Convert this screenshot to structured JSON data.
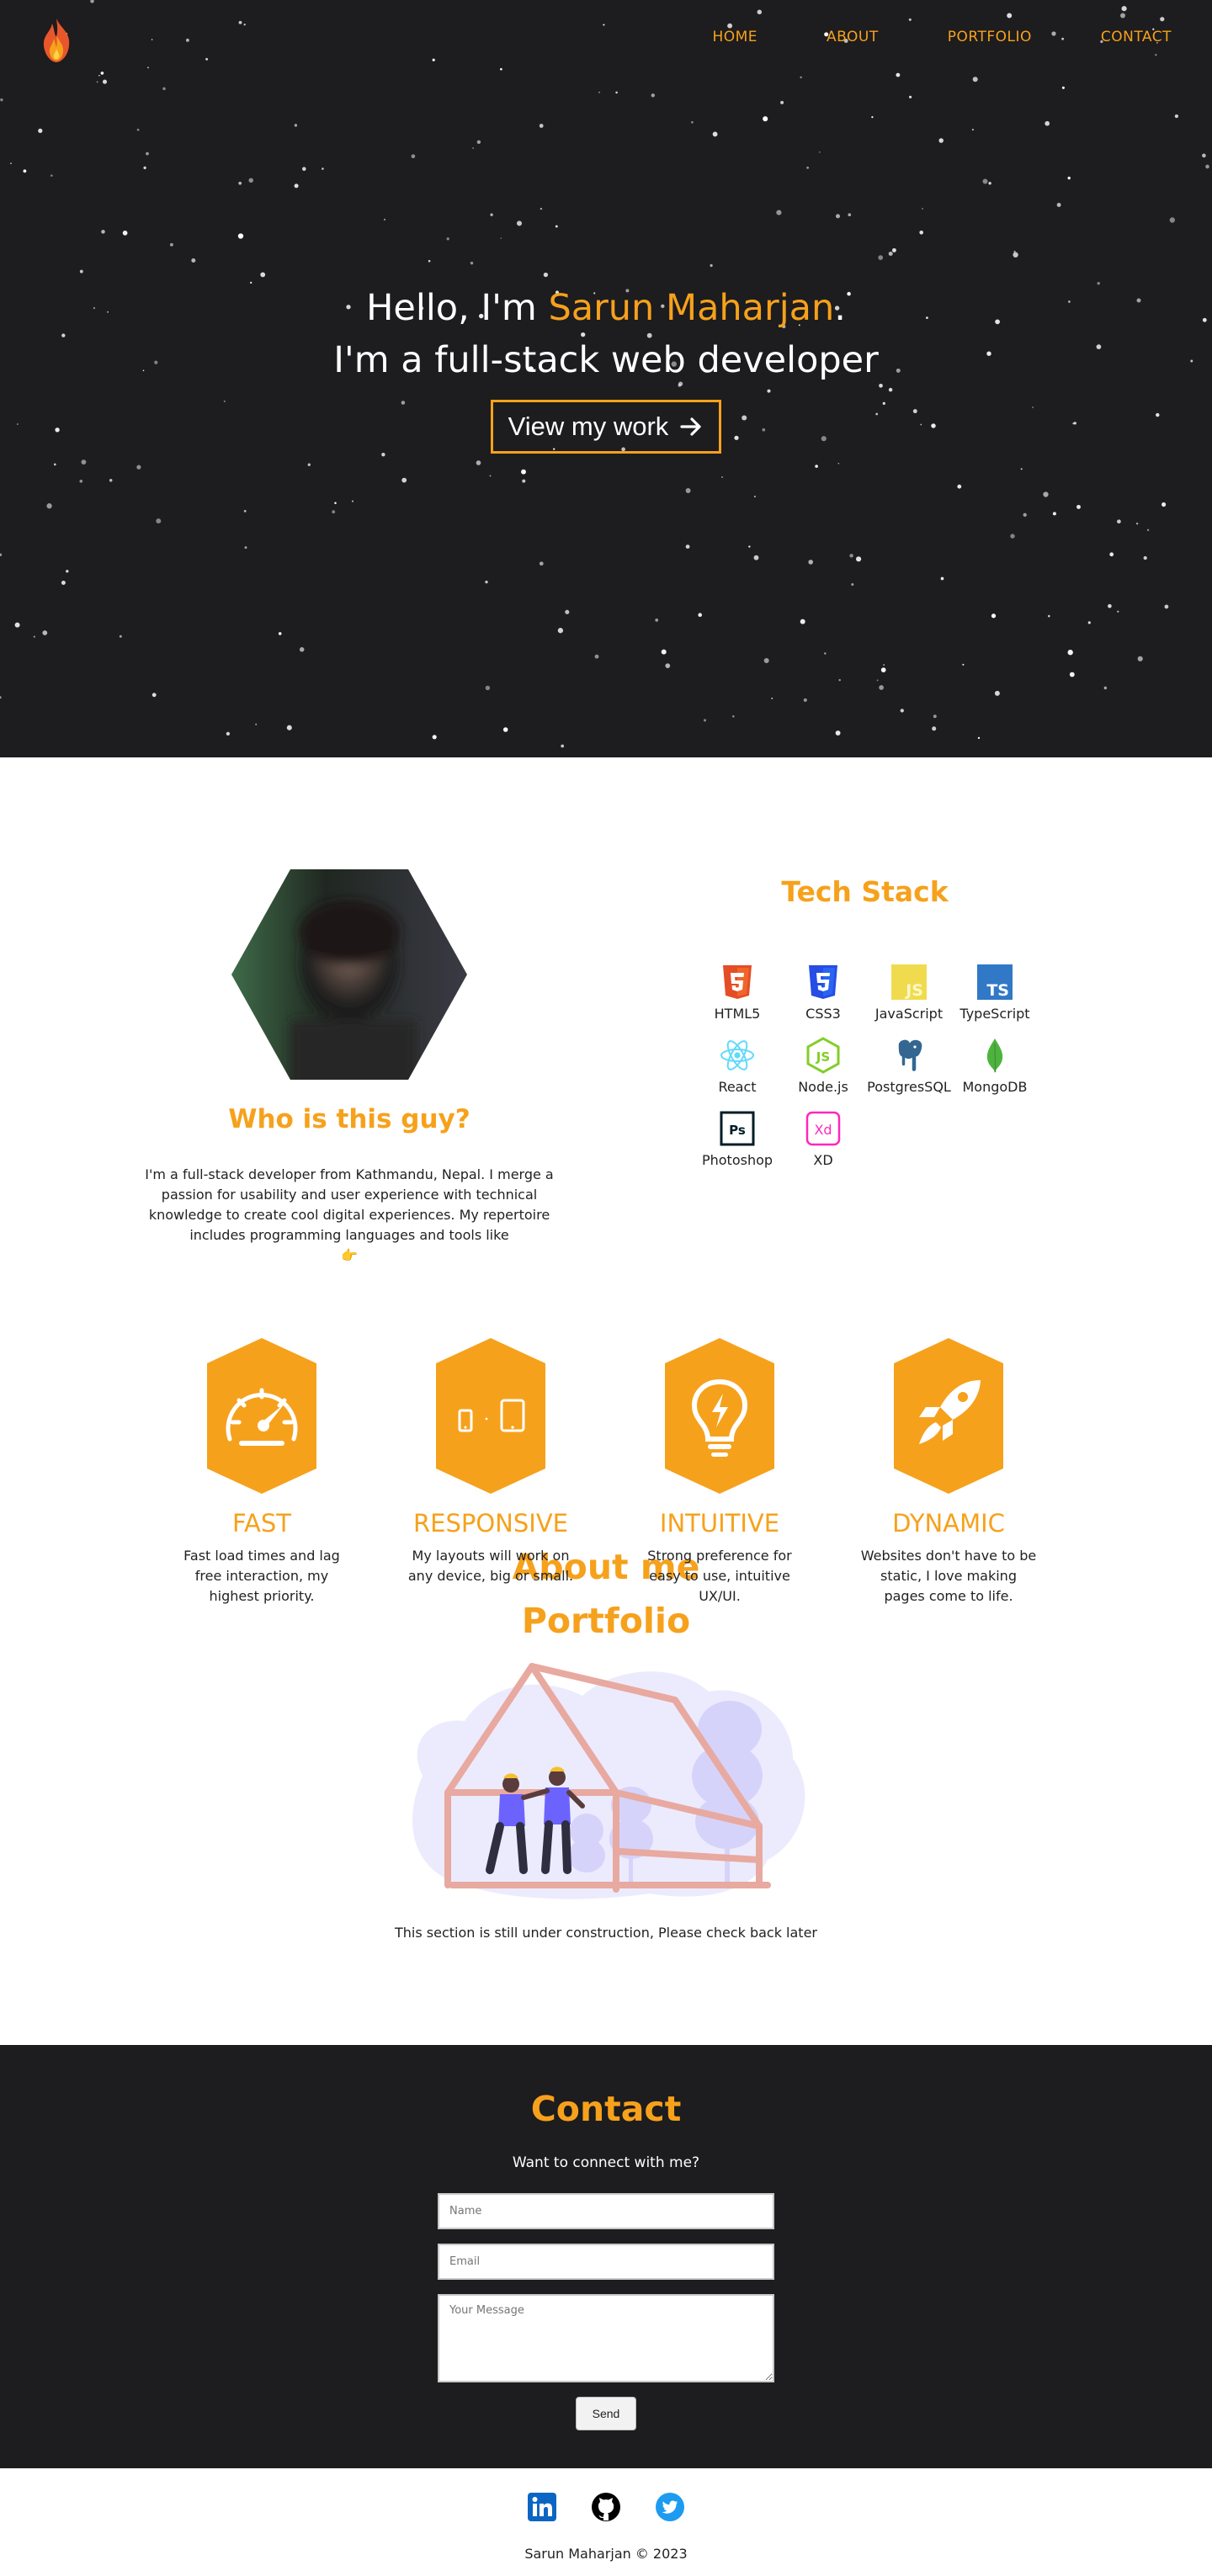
{
  "nav": {
    "items": [
      {
        "label": "HOME"
      },
      {
        "label": "ABOUT"
      },
      {
        "label": "PORTFOLIO"
      },
      {
        "label": "CONTACT"
      }
    ]
  },
  "hero": {
    "greeting_prefix": "Hello, I'm ",
    "name": "Sarun Maharjan",
    "greeting_suffix": ".",
    "tagline": "I'm a full-stack web developer",
    "cta_label": "View my work"
  },
  "about": {
    "title": "About me",
    "who_title": "Who is this guy?",
    "who_text": "I'm a full-stack developer from Kathmandu, Nepal. I merge a passion for usability and user experience with technical knowledge to create cool digital experiences. My repertoire includes programming languages and tools like",
    "who_emoji": "👉",
    "tech_title": "Tech Stack",
    "tech": [
      {
        "label": "HTML5",
        "icon": "html5-icon",
        "color": "#e44d26"
      },
      {
        "label": "CSS3",
        "icon": "css3-icon",
        "color": "#264de4"
      },
      {
        "label": "JavaScript",
        "icon": "javascript-icon",
        "color": "#f0db4f"
      },
      {
        "label": "TypeScript",
        "icon": "typescript-icon",
        "color": "#3178c6"
      },
      {
        "label": "React",
        "icon": "react-icon",
        "color": "#61dafb"
      },
      {
        "label": "Node.js",
        "icon": "nodejs-icon",
        "color": "#83cd29"
      },
      {
        "label": "PostgresSQL",
        "icon": "postgresql-icon",
        "color": "#336791"
      },
      {
        "label": "MongoDB",
        "icon": "mongodb-icon",
        "color": "#4db33d"
      },
      {
        "label": "Photoshop",
        "icon": "photoshop-icon",
        "color": "#001d26"
      },
      {
        "label": "XD",
        "icon": "adobe-xd-icon",
        "color": "#ff26be"
      }
    ],
    "features": [
      {
        "title": "FAST",
        "text": "Fast load times and lag free interaction, my highest priority.",
        "icon": "speedometer-icon"
      },
      {
        "title": "RESPONSIVE",
        "text": "My layouts will work on any device, big or small.",
        "icon": "devices-icon"
      },
      {
        "title": "INTUITIVE",
        "text": "Strong preference for easy to use, intuitive UX/UI.",
        "icon": "lightbulb-icon"
      },
      {
        "title": "DYNAMIC",
        "text": "Websites don't have to be static, I love making pages come to life.",
        "icon": "rocket-icon"
      }
    ]
  },
  "portfolio": {
    "title": "Portfolio",
    "note": "This section is still under construction, Please check back later"
  },
  "contact": {
    "title": "Contact",
    "subtitle": "Want to connect with me?",
    "name_placeholder": "Name",
    "email_placeholder": "Email",
    "message_placeholder": "Your Message",
    "send_label": "Send"
  },
  "footer": {
    "socials": [
      {
        "icon": "linkedin-icon",
        "color": "#0a66c2"
      },
      {
        "icon": "github-icon",
        "color": "#000000"
      },
      {
        "icon": "twitter-icon",
        "color": "#1d9bf0"
      }
    ],
    "copyright": "Sarun Maharjan © 2023"
  },
  "colors": {
    "accent": "#f6a11c",
    "dark_bg": "#1d1c1e"
  }
}
